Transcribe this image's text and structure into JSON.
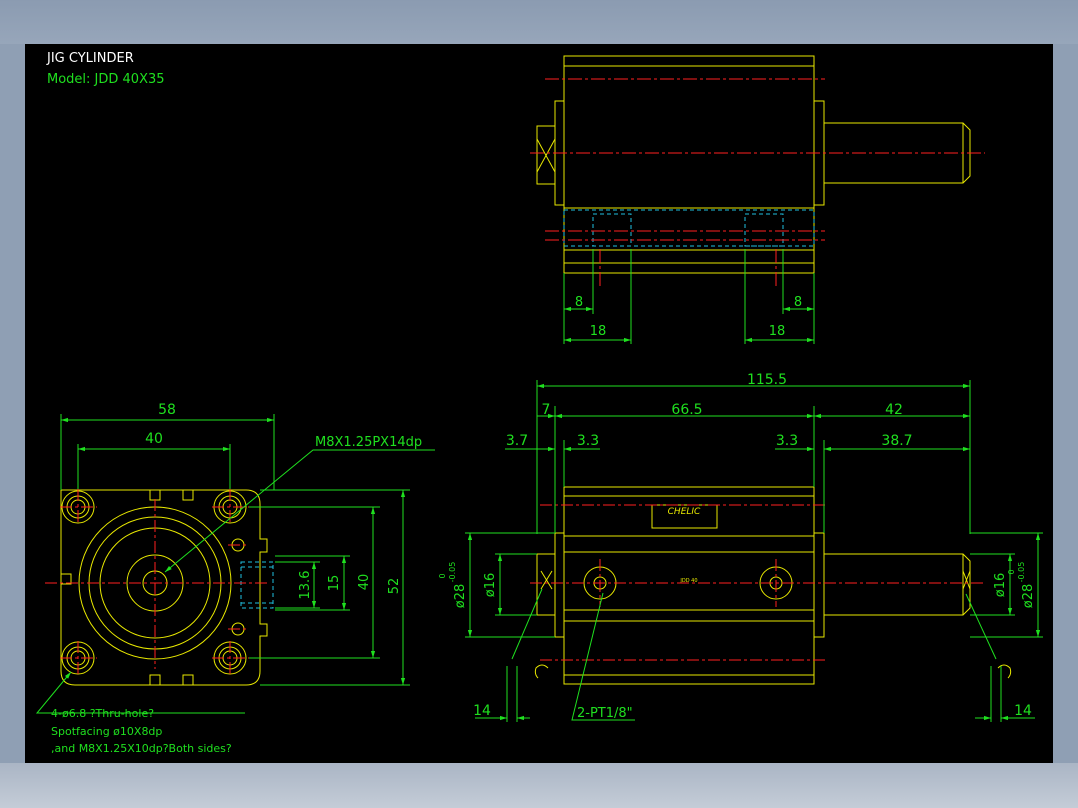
{
  "title": {
    "line1": "JIG CYLINDER",
    "line2": "Model:  JDD  40X35"
  },
  "colors": {
    "background": "#000000",
    "outline": "#e8e800",
    "dimension": "#1fe01f",
    "centerline": "#ff2020",
    "hidden": "#20c0e0",
    "title": "#ffffff"
  },
  "top_view": {
    "dims": {
      "left_8": "8",
      "right_8": "8",
      "left_18": "18",
      "right_18": "18"
    }
  },
  "front_view": {
    "dims": {
      "width_58": "58",
      "width_40": "40",
      "height_13_6": "13.6",
      "height_15": "15",
      "height_40": "40",
      "height_52": "52"
    },
    "thread_callout": "M8X1.25PX14dp",
    "hole_note": {
      "line1": "4-ø6.8  ?Thru-hole?",
      "line2": "Spotfacing  ø10X8dp",
      "line3": ",and M8X1.25X10dp?Both sides?"
    }
  },
  "side_view": {
    "dims": {
      "overall": "115.5",
      "d7": "7",
      "d66_5": "66.5",
      "d42": "42",
      "d3_7": "3.7",
      "d3_3_left": "3.3",
      "d3_3_right": "3.3",
      "d38_7": "38.7",
      "dia16_left": "ø16",
      "dia28_left": "ø28",
      "tol_left_upper": "0",
      "tol_left_lower": "-0.05",
      "dia16_right": "ø16",
      "dia28_right": "ø28",
      "tol_right_upper": "0",
      "tol_right_lower": "-0.05",
      "d14_left": "14",
      "d14_right": "14"
    },
    "port_callout": "2-PT1/8\"",
    "label_brand": "CHELIC",
    "label_center": "JDD 40"
  }
}
